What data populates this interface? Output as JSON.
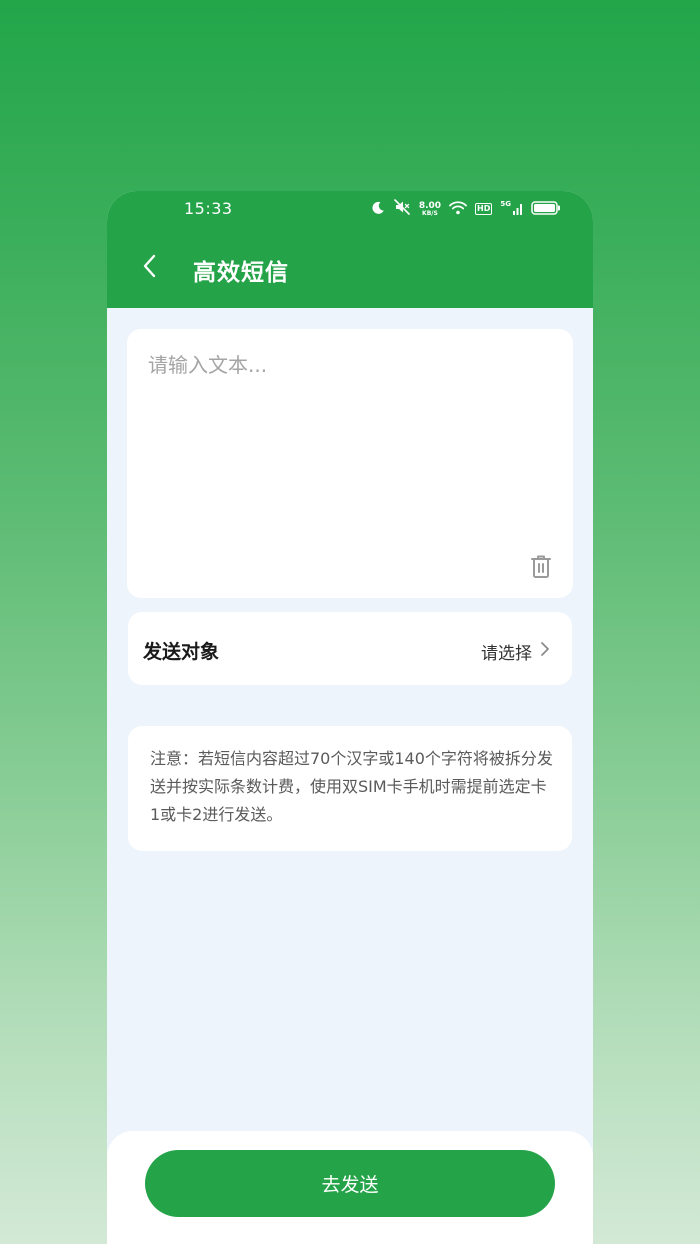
{
  "status_bar": {
    "time": "15:33",
    "net_speed_value": "8.00",
    "net_speed_unit": "KB/S",
    "hd_label": "HD",
    "network_gen": "5G",
    "icons": [
      "moon-icon",
      "mute-icon",
      "wifi-icon",
      "signal-icon",
      "battery-icon"
    ]
  },
  "header": {
    "title": "高效短信",
    "back_icon": "chevron-left-icon"
  },
  "message": {
    "placeholder": "请输入文本...",
    "value": "",
    "clear_icon": "trash-icon"
  },
  "recipient": {
    "label": "发送对象",
    "value": "请选择",
    "chevron_icon": "chevron-right-icon"
  },
  "note": {
    "text": "注意：若短信内容超过70个汉字或140个字符将被拆分发送并按实际条数计费，使用双SIM卡手机时需提前选定卡1或卡2进行发送。"
  },
  "footer": {
    "send_label": "去发送"
  },
  "colors": {
    "brand_green": "#25a349",
    "content_bg": "#eef4fb",
    "card_bg": "#ffffff"
  }
}
